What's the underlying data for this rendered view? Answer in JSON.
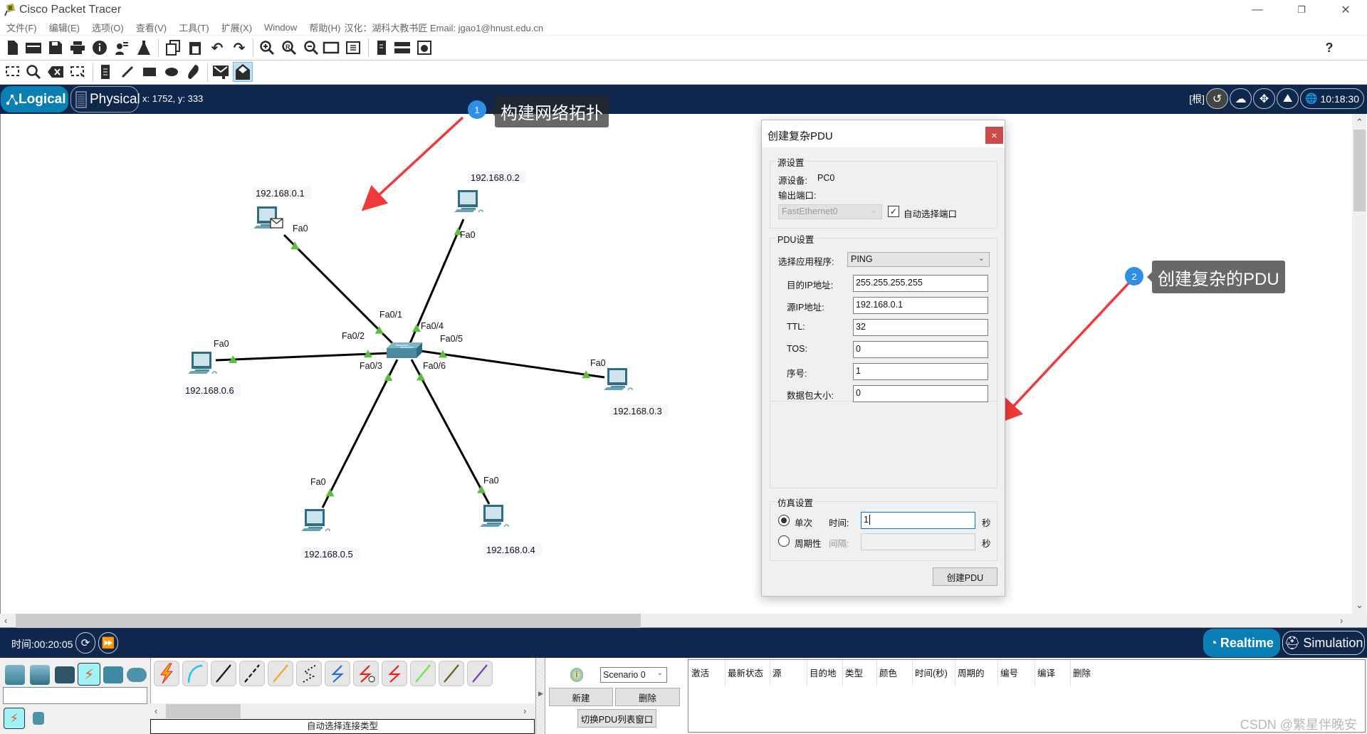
{
  "window": {
    "title": "Cisco Packet Tracer",
    "controls": [
      "—",
      "❐",
      "✕"
    ]
  },
  "menu": [
    "文件(F)",
    "编辑(E)",
    "选项(O)",
    "查看(V)",
    "工具(T)",
    "扩展(X)",
    "Window",
    "帮助(H)",
    "汉化：湖科大教书匠  Email: jgao1@hnust.edu.cn"
  ],
  "toolbar_main": {
    "icons": [
      "new-file-icon",
      "open-folder-icon",
      "save-icon",
      "print-icon",
      "info-icon",
      "activity-wizard-icon",
      "custom-device-icon",
      "copy-icon",
      "paste-icon",
      "undo-icon",
      "redo-icon",
      "zoom-in-icon",
      "zoom-reset-icon",
      "zoom-out-icon",
      "drawing-palette-icon",
      "custom-devices-dialog-icon",
      "cluster-icon",
      "pdu-device-icon",
      "cloud-image-icon"
    ],
    "help": "?"
  },
  "toolbar_secondary": {
    "icons": [
      "select-icon",
      "inspect-icon",
      "delete-icon",
      "resize-shape-icon",
      "note-icon",
      "draw-line-icon",
      "draw-rectangle-icon",
      "draw-ellipse-icon",
      "freeform-icon",
      "add-simple-pdu-icon",
      "add-complex-pdu-icon"
    ]
  },
  "nav": {
    "logical": "Logical",
    "physical": "Physical",
    "coords": "x: 1752, y: 333",
    "root": "[根]",
    "time": "10:18:30"
  },
  "topology": {
    "switch_ports": [
      "Fa0/1",
      "Fa0/2",
      "Fa0/3",
      "Fa0/4",
      "Fa0/5",
      "Fa0/6"
    ],
    "pcs": [
      {
        "ip": "192.168.0.1",
        "port": "Fa0",
        "switch_port": "Fa0/1",
        "has_pdu": true
      },
      {
        "ip": "192.168.0.2",
        "port": "Fa0",
        "switch_port": "Fa0/4",
        "has_pdu": false
      },
      {
        "ip": "192.168.0.3",
        "port": "Fa0",
        "switch_port": "Fa0/5",
        "has_pdu": false
      },
      {
        "ip": "192.168.0.4",
        "port": "Fa0",
        "switch_port": "Fa0/6",
        "has_pdu": false
      },
      {
        "ip": "192.168.0.5",
        "port": "Fa0",
        "switch_port": "Fa0/3",
        "has_pdu": false
      },
      {
        "ip": "192.168.0.6",
        "port": "Fa0",
        "switch_port": "Fa0/2",
        "has_pdu": false
      }
    ],
    "link_color": "#000000",
    "port_up_color": "#5cbf3a"
  },
  "callouts": [
    {
      "number": "1",
      "text": "构建网络拓扑"
    },
    {
      "number": "2",
      "text": "创建复杂的PDU"
    }
  ],
  "dialog": {
    "title": "创建复杂PDU",
    "close": "×",
    "source": {
      "group": "源设置",
      "device_label": "源设备:",
      "device_value": "PC0",
      "port_label": "输出端口:",
      "port_value": "FastEthernet0",
      "auto_port_label": "自动选择端口",
      "auto_port_checked": true
    },
    "pdu": {
      "group": "PDU设置",
      "app_label": "选择应用程序:",
      "app_value": "PING",
      "dest_ip_label": "目的IP地址:",
      "dest_ip": "255.255.255.255",
      "src_ip_label": "源IP地址:",
      "src_ip": "192.168.0.1",
      "ttl_label": "TTL:",
      "ttl": "32",
      "tos_label": "TOS:",
      "tos": "0",
      "seq_label": "序号:",
      "seq": "1",
      "size_label": "数据包大小:",
      "size": "0"
    },
    "sim": {
      "group": "仿真设置",
      "once_label": "单次",
      "once_selected": true,
      "time_label": "时间:",
      "time_value": "1",
      "unit": "秒",
      "periodic_label": "周期性",
      "interval_label": "间隔:",
      "interval_value": "",
      "unit2": "秒"
    },
    "create_button": "创建PDU"
  },
  "simbar": {
    "time": "时间:00:20:05",
    "realtime": "Realtime",
    "simulation": "Simulation"
  },
  "bottom": {
    "connection_type_label": "自动选择连接类型",
    "connections": [
      "automatic",
      "console",
      "copper-straight",
      "copper-cross",
      "fiber",
      "phone",
      "coaxial",
      "serial-dce",
      "serial-dte",
      "octal",
      "iot-custom",
      "usb"
    ],
    "scenario": {
      "selected": "Scenario 0",
      "new": "新建",
      "delete": "删除",
      "toggle": "切换PDU列表窗口"
    },
    "pdu_columns": [
      "激活",
      "最新状态",
      "源",
      "目的地",
      "类型",
      "颜色",
      "时间(秒)",
      "周期的",
      "编号",
      "编译",
      "删除"
    ]
  },
  "watermark": "CSDN @繁星伴晚安"
}
